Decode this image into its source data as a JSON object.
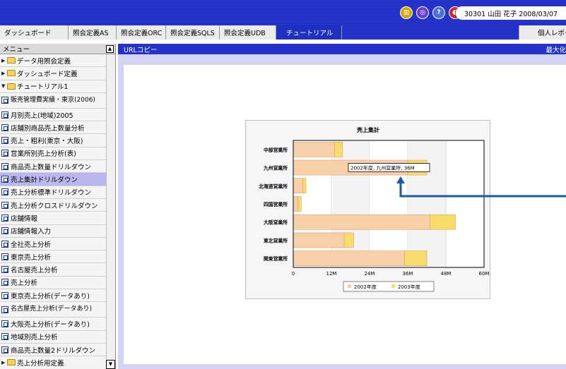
{
  "header": {
    "icons": [
      {
        "name": "chart-report-icon",
        "glyph": "▥",
        "color": "#d6a400"
      },
      {
        "name": "document-link-icon",
        "glyph": "◎",
        "color": "#6a3fd1"
      },
      {
        "name": "help-icon",
        "glyph": "?",
        "color": "#4a6fe0"
      },
      {
        "name": "logout-icon",
        "glyph": "◐",
        "color": "#c03030"
      }
    ],
    "user_info": "30301 山田 花子  2008/03/07"
  },
  "tabs": [
    "ダッシュボード",
    "照会定義AS",
    "照会定義ORC",
    "照会定義SQLS",
    "照会定義UDB",
    "チュートリアル"
  ],
  "active_tab": 5,
  "report_tab": "個人レポート",
  "menu": {
    "title": "メニュー",
    "folders": [
      {
        "label": "データ用照会定義",
        "expanded": false
      },
      {
        "label": "ダッシュボード定義",
        "expanded": false
      },
      {
        "label": "チュートリアル1",
        "expanded": true
      }
    ],
    "items": [
      "販売管理費実績・東京(2006)",
      "月別売上(地域)2005",
      "店舗別商品売上数量分析",
      "売上・粗利(東京・大阪)",
      "営業所別売上分析(表)",
      "商品売上数量ドリルダウン",
      "売上集計ドリルダウン",
      "売上分析標準ドリルダウン",
      "売上分析クロスドリルダウン",
      "店舗情報",
      "店舗情報入力",
      "全社売上分析",
      "東京売上分析",
      "名古屋売上分析",
      "売上分析",
      "東京売上分析(データあり)",
      "名古屋売上分析(データあり)",
      "大阪売上分析(データあり)",
      "地域別売上分析",
      "商品売上数量2ドリルダウン"
    ],
    "selected_item": 6,
    "cut_off_folder": "売上分析用定義"
  },
  "content": {
    "url_label": "URLコピー",
    "maximize_label": "最大化"
  },
  "chart_data": {
    "type": "bar",
    "orientation": "horizontal",
    "stacked": true,
    "title": "売上集計",
    "categories": [
      "中部営業所",
      "九州営業所",
      "北海道営業所",
      "四国営業所",
      "大阪営業所",
      "東北営業所",
      "関東営業所"
    ],
    "series": [
      {
        "name": "2002年度",
        "color": "#f7cfa8",
        "values": [
          13,
          36,
          3,
          1.5,
          43,
          16,
          35
        ]
      },
      {
        "name": "2003年度",
        "color": "#f7dc6b",
        "values": [
          2.5,
          6,
          1,
          1,
          8,
          3,
          7
        ]
      }
    ],
    "x_ticks": [
      "0",
      "12M",
      "24M",
      "36M",
      "48M",
      "60M"
    ],
    "xlim": [
      0,
      60
    ],
    "tooltip": "2002年度, 九州営業所, 36M",
    "legend_position": "bottom"
  },
  "annotation_arrow_color": "#1a5aa8"
}
